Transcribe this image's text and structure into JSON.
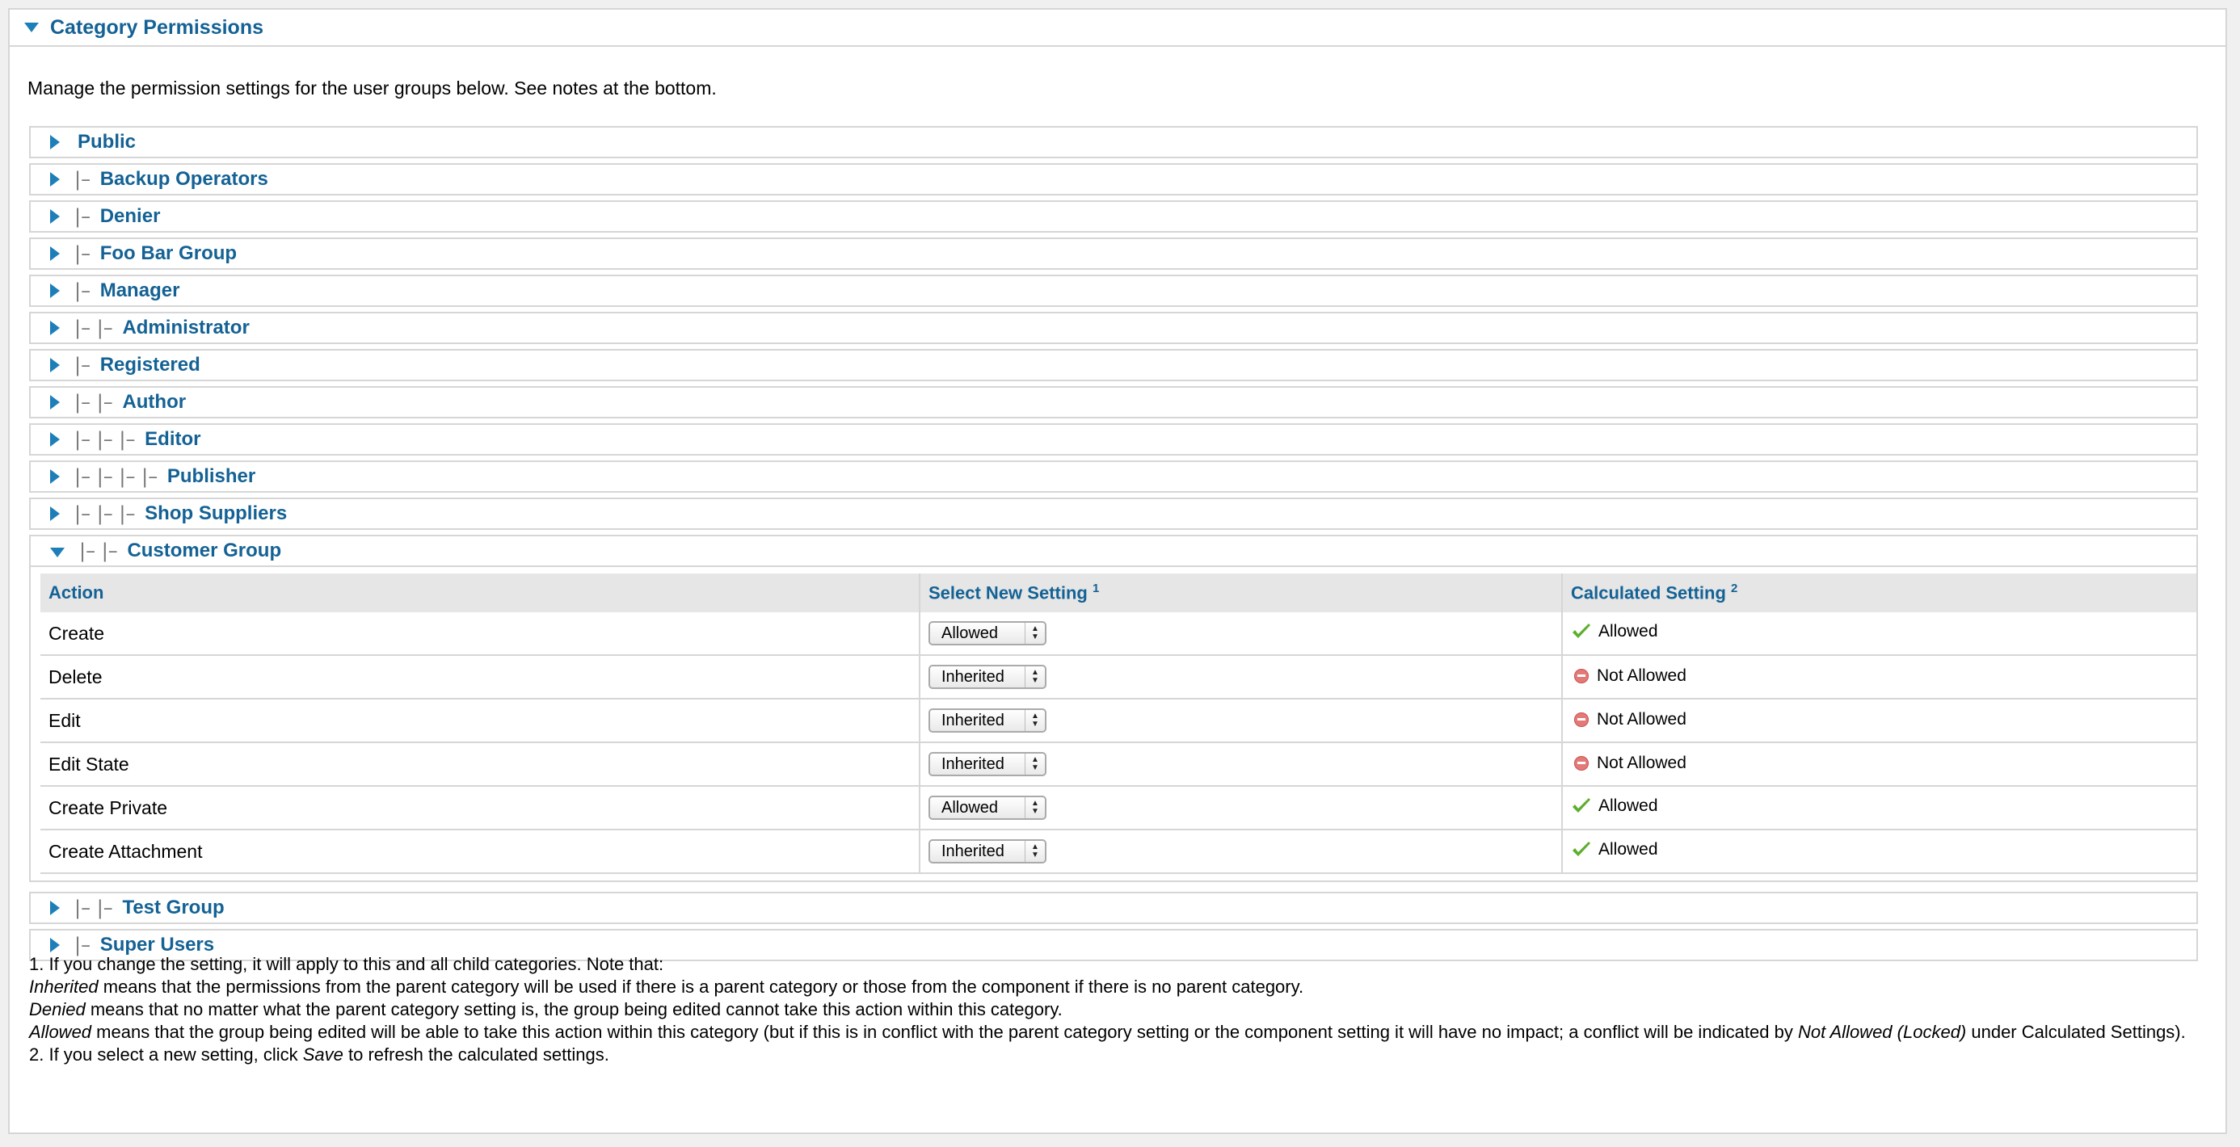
{
  "panel": {
    "title": "Category Permissions"
  },
  "intro": "Manage the permission settings for the user groups below. See notes at the bottom.",
  "groups_before": [
    {
      "prefix": "",
      "name": "Public"
    },
    {
      "prefix": "|– ",
      "name": "Backup Operators"
    },
    {
      "prefix": "|– ",
      "name": "Denier"
    },
    {
      "prefix": "|– ",
      "name": "Foo Bar Group"
    },
    {
      "prefix": "|– ",
      "name": "Manager"
    },
    {
      "prefix": "|– |– ",
      "name": "Administrator"
    },
    {
      "prefix": "|– ",
      "name": "Registered"
    },
    {
      "prefix": "|– |– ",
      "name": "Author"
    },
    {
      "prefix": "|– |– |– ",
      "name": "Editor"
    },
    {
      "prefix": "|– |– |– |– ",
      "name": "Publisher"
    },
    {
      "prefix": "|– |– |– ",
      "name": "Shop Suppliers"
    }
  ],
  "expanded_group": {
    "prefix": "|– |– ",
    "name": "Customer Group"
  },
  "table": {
    "headers": {
      "action": "Action",
      "select": "Select New Setting",
      "select_sup": "1",
      "calc": "Calculated Setting",
      "calc_sup": "2"
    },
    "rows": [
      {
        "action": "Create",
        "setting": "Allowed",
        "calc": "Allowed",
        "allowed": true
      },
      {
        "action": "Delete",
        "setting": "Inherited",
        "calc": "Not Allowed",
        "allowed": false
      },
      {
        "action": "Edit",
        "setting": "Inherited",
        "calc": "Not Allowed",
        "allowed": false
      },
      {
        "action": "Edit State",
        "setting": "Inherited",
        "calc": "Not Allowed",
        "allowed": false
      },
      {
        "action": "Create Private",
        "setting": "Allowed",
        "calc": "Allowed",
        "allowed": true
      },
      {
        "action": "Create Attachment",
        "setting": "Inherited",
        "calc": "Allowed",
        "allowed": true
      }
    ]
  },
  "groups_after": [
    {
      "prefix": "|– |– ",
      "name": "Test Group"
    },
    {
      "prefix": "|– ",
      "name": "Super Users"
    }
  ],
  "notes": {
    "n1": "1. If you change the setting, it will apply to this and all child categories. Note that:",
    "inherited_term": "Inherited",
    "inherited_text": " means that the permissions from the parent category will be used if there is a parent category or those from the component if there is no parent category.",
    "denied_term": "Denied",
    "denied_text": " means that no matter what the parent category setting is, the group being edited cannot take this action within this category.",
    "allowed_term": "Allowed",
    "allowed_text": " means that the group being edited will be able to take this action within this category (but if this is in conflict with the parent category setting or the component setting it will have no impact; a conflict will be indicated by ",
    "not_allowed_locked": "Not Allowed (Locked)",
    "allowed_text_end": " under Calculated Settings).",
    "n2_start": "2. If you select a new setting, click ",
    "save_term": "Save",
    "n2_end": " to refresh the calculated settings."
  },
  "colors": {
    "accent": "#146295",
    "triangle": "#1e7fb8",
    "border": "#d6d6d6",
    "check": "#5cae2d",
    "deny": "#e47a78"
  }
}
